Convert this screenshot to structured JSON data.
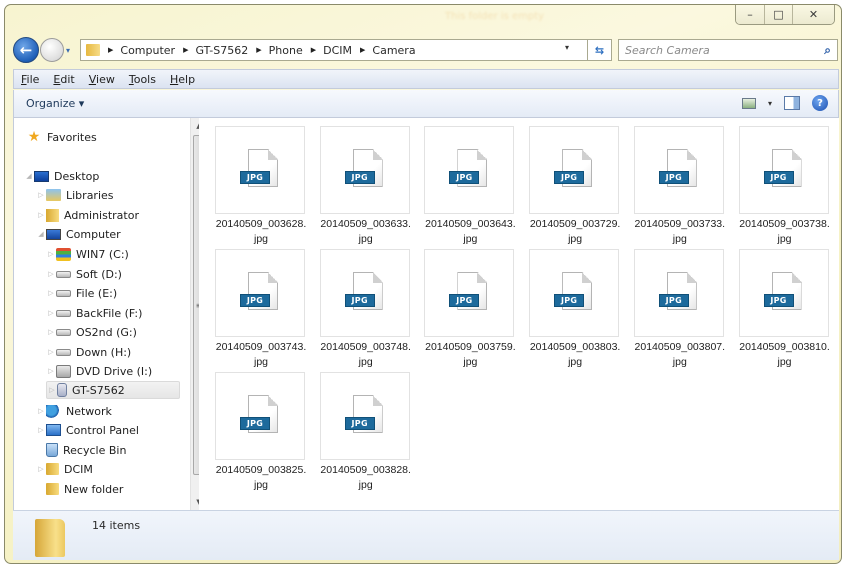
{
  "window": {
    "title": "This folder is empty",
    "controls": {
      "minimize": "–",
      "maximize": "□",
      "close": "✕"
    }
  },
  "navigation": {
    "back_icon": "←",
    "history_icon": "▾",
    "breadcrumbs": [
      "Computer",
      "GT-S7562",
      "Phone",
      "DCIM",
      "Camera"
    ],
    "breadcrumb_separator": "▶",
    "address_dropdown_icon": "▾",
    "refresh_icon": "⇆",
    "search_placeholder": "Search Camera",
    "search_icon": "⌕"
  },
  "menubar": {
    "items": [
      {
        "accel": "F",
        "rest": "ile"
      },
      {
        "accel": "E",
        "rest": "dit"
      },
      {
        "accel": "V",
        "rest": "iew"
      },
      {
        "accel": "T",
        "rest": "ools"
      },
      {
        "accel": "H",
        "rest": "elp"
      }
    ]
  },
  "toolbar": {
    "organize_label": "Organize ▾",
    "view_dropdown": "▾",
    "help_label": "?"
  },
  "sidebar": {
    "scroll_up": "▲",
    "scroll_down": "▼",
    "scroll_grip": "≡",
    "items": [
      {
        "label": "Favorites",
        "icon": "star-icon"
      },
      {
        "label": "Desktop",
        "icon": "desktop-icon",
        "expander": "◢"
      },
      {
        "label": "Libraries",
        "icon": "libraries-icon",
        "expander": "▷"
      },
      {
        "label": "Administrator",
        "icon": "user-folder-icon",
        "expander": "▷"
      },
      {
        "label": "Computer",
        "icon": "computer-icon",
        "expander": "◢"
      },
      {
        "label": "WIN7 (C:)",
        "icon": "windows-drive-icon",
        "expander": "▷"
      },
      {
        "label": "Soft (D:)",
        "icon": "drive-icon",
        "expander": "▷"
      },
      {
        "label": "File (E:)",
        "icon": "drive-icon",
        "expander": "▷"
      },
      {
        "label": "BackFile (F:)",
        "icon": "drive-icon",
        "expander": "▷"
      },
      {
        "label": "OS2nd (G:)",
        "icon": "drive-icon",
        "expander": "▷"
      },
      {
        "label": "Down (H:)",
        "icon": "drive-icon",
        "expander": "▷"
      },
      {
        "label": "DVD Drive (I:)",
        "icon": "dvd-drive-icon",
        "expander": "▷"
      },
      {
        "label": "GT-S7562",
        "icon": "phone-icon",
        "expander": "▷",
        "selected": true
      },
      {
        "label": "Network",
        "icon": "network-icon",
        "expander": "▷"
      },
      {
        "label": "Control Panel",
        "icon": "control-panel-icon",
        "expander": "▷"
      },
      {
        "label": "Recycle Bin",
        "icon": "recycle-bin-icon"
      },
      {
        "label": "DCIM",
        "icon": "folder-icon",
        "expander": "▷"
      },
      {
        "label": "New folder",
        "icon": "folder-icon"
      }
    ]
  },
  "files": {
    "badge": "JPG",
    "items": [
      {
        "name": "20140509_003628.",
        "ext": "jpg"
      },
      {
        "name": "20140509_003633.",
        "ext": "jpg"
      },
      {
        "name": "20140509_003643.",
        "ext": "jpg"
      },
      {
        "name": "20140509_003729.",
        "ext": "jpg"
      },
      {
        "name": "20140509_003733.",
        "ext": "jpg"
      },
      {
        "name": "20140509_003738.",
        "ext": "jpg"
      },
      {
        "name": "20140509_003743.",
        "ext": "jpg"
      },
      {
        "name": "20140509_003748.",
        "ext": "jpg"
      },
      {
        "name": "20140509_003759.",
        "ext": "jpg"
      },
      {
        "name": "20140509_003803.",
        "ext": "jpg"
      },
      {
        "name": "20140509_003807.",
        "ext": "jpg"
      },
      {
        "name": "20140509_003810.",
        "ext": "jpg"
      },
      {
        "name": "20140509_003825.",
        "ext": "jpg"
      },
      {
        "name": "20140509_003828.",
        "ext": "jpg"
      }
    ]
  },
  "details": {
    "item_count": "14 items"
  },
  "colors": {
    "frame": "#f7f4d0",
    "jpg_badge": "#1d6a9c",
    "back_button": "#1e5fb8"
  }
}
